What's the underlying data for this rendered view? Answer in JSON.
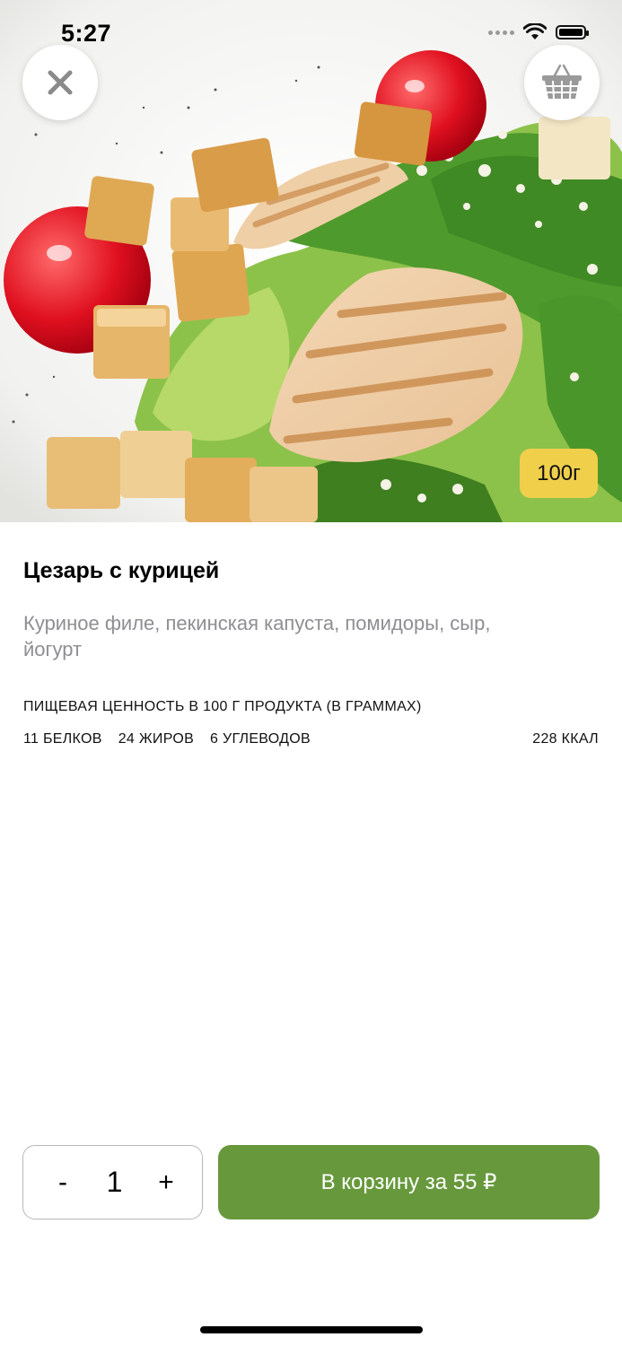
{
  "status_bar": {
    "time": "5:27"
  },
  "hero": {
    "icons": {
      "close": "close-icon",
      "cart": "basket-icon"
    },
    "weight": "100г",
    "weight_color": "#f0cf4b"
  },
  "product": {
    "title": "Цезарь с курицей",
    "description": "Куриное филе, пекинская капуста, помидоры, сыр, йогурт",
    "nutrition": {
      "heading": "ПИЩЕВАЯ ЦЕННОСТЬ В 100 Г ПРОДУКТА (В ГРАММАХ)",
      "proteins": "11 БЕЛКОВ",
      "fats": "24 ЖИРОВ",
      "carbs": "6 УГЛЕВОДОВ",
      "kcal": "228 ККАЛ"
    }
  },
  "order": {
    "minus": "-",
    "quantity": "1",
    "plus": "+",
    "add_button": "В корзину за 55 ₽",
    "accent_color": "#67993c"
  }
}
